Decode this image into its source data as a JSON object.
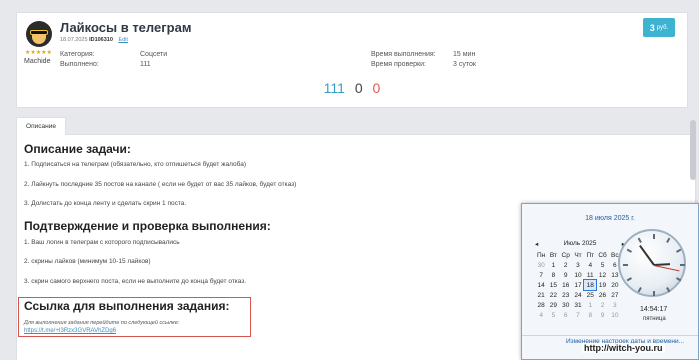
{
  "task": {
    "title": "Лайкосы в телеграм",
    "date": "18.07.2025",
    "id": "ID106310",
    "edit_link": "Edit",
    "author": "Machide",
    "price_value": "3",
    "price_unit": "руб.",
    "category_label": "Категория:",
    "category_value": "Соцсети",
    "done_label": "Выполнено:",
    "done_value": "111",
    "exec_time_label": "Время выполнения:",
    "exec_time_value": "15 мин",
    "check_time_label": "Время проверки:",
    "check_time_value": "3 суток"
  },
  "counts": {
    "accepted": "111",
    "pending": "0",
    "rejected": "0"
  },
  "tab_label": "Описание",
  "description": {
    "heading": "Описание задачи:",
    "items": [
      "1. Подписаться на телеграм (обязательно, кто отпишеться будет жалоба)",
      "2. Лайкнуть последние 35 постов на канале ( если не будет от вас 35 лайков, будет отказ)",
      "3. Долистать до конца ленту и сделать скрин 1 поста."
    ]
  },
  "confirmation": {
    "heading": "Подтверждение и проверка выполнения:",
    "items": [
      "1. Ваш логин в телеграм с которого подписывались",
      "2. скрины лайков (минимум 10-15 лайков)",
      "3. скрин самого верхнего поста, если не выполните до конца будет отказ."
    ]
  },
  "link_section": {
    "heading": "Ссылка для выполнения задания:",
    "note": "Для выполнения задания перейдите по следующей ссылке:",
    "url": "https://t.me/+I3Rzx3GVRAVhZDg6"
  },
  "clock": {
    "date": "18 июля 2025 г.",
    "month": "Июль 2025",
    "weekdays": [
      "Пн",
      "Вт",
      "Ср",
      "Чт",
      "Пт",
      "Сб",
      "Вс"
    ],
    "weeks": [
      [
        "30",
        "1",
        "2",
        "3",
        "4",
        "5",
        "6"
      ],
      [
        "7",
        "8",
        "9",
        "10",
        "11",
        "12",
        "13"
      ],
      [
        "14",
        "15",
        "16",
        "17",
        "18",
        "19",
        "20"
      ],
      [
        "21",
        "22",
        "23",
        "24",
        "25",
        "26",
        "27"
      ],
      [
        "28",
        "29",
        "30",
        "31",
        "1",
        "2",
        "3"
      ],
      [
        "4",
        "5",
        "6",
        "7",
        "8",
        "9",
        "10"
      ]
    ],
    "today": "18",
    "time": "14:54:17",
    "weekday": "пятница",
    "change_link": "Изменение настроек даты и времени..."
  },
  "watermark": "http://witch-you.ru",
  "colors": {
    "accent": "#3db3d1",
    "rejected": "#e05a4f",
    "link_box": "#d9534f"
  }
}
